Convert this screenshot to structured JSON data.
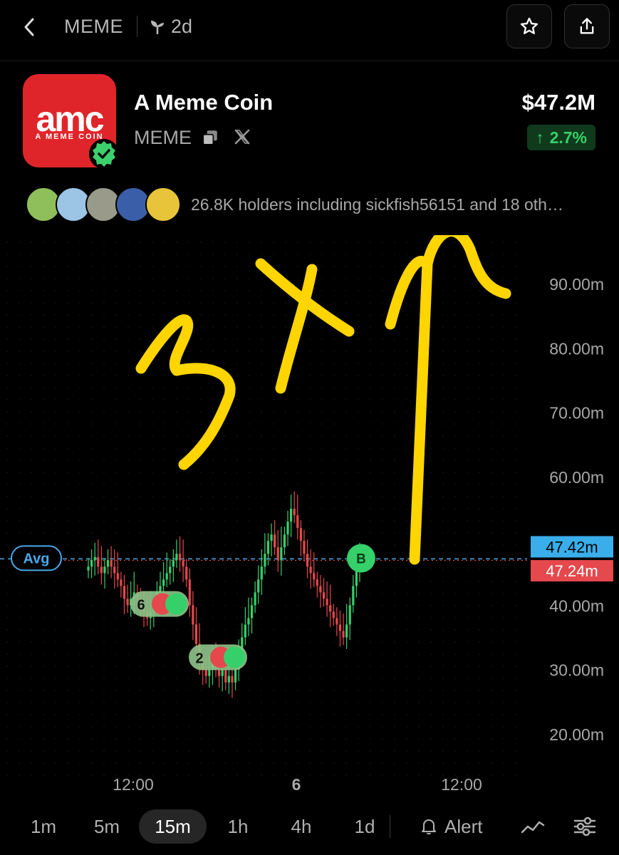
{
  "header": {
    "ticker": "MEME",
    "age": "2d"
  },
  "token": {
    "logo_wordmark": "amc",
    "logo_sub": "A MEME COIN",
    "name": "A Meme Coin",
    "symbol": "MEME",
    "market_cap": "$47.2M",
    "change": "2.7%",
    "change_arrow": "↑"
  },
  "holders": {
    "text": "26.8K holders including sickfish56151 and 18 oth…",
    "avatar_colors": [
      "#8fbf5a",
      "#9cc4e4",
      "#9a9a8a",
      "#3a5fa8",
      "#e8c43a"
    ]
  },
  "colors": {
    "up": "#35d06a",
    "down": "#e5484d",
    "annotation": "#ffd500",
    "avg_line": "#4aa8e8"
  },
  "chart_data": {
    "type": "candlestick",
    "y_unit": "market cap (m)",
    "y_ticks": [
      "90.00m",
      "80.00m",
      "70.00m",
      "60.00m",
      "40.00m",
      "30.00m",
      "20.00m"
    ],
    "y_tick_values": [
      90,
      80,
      70,
      60,
      40,
      30,
      20
    ],
    "ylim": [
      15,
      97
    ],
    "x_ticks": [
      "12:00",
      "6",
      "12:00"
    ],
    "avg_label": "Avg",
    "avg_value": 47.42,
    "current_label": "47.24m",
    "current_value": 47.24,
    "avg_price_label": "47.42m",
    "trade_markers": [
      {
        "label": "6",
        "at_value": 40.2
      },
      {
        "label": "2",
        "at_value": 31.9
      },
      {
        "label": "B",
        "at_value": 47.3
      }
    ],
    "candles_close": [
      46,
      47,
      47.5,
      46,
      45,
      46,
      47,
      46,
      45,
      44,
      43,
      41,
      40,
      41,
      42,
      41,
      40,
      39,
      38,
      39,
      40,
      42,
      43,
      44,
      45,
      46,
      47,
      48,
      47,
      46,
      44,
      40,
      37,
      34,
      31,
      30,
      29,
      30,
      31,
      30,
      29,
      30,
      28,
      29,
      28,
      30,
      33,
      35,
      37,
      38,
      40,
      42,
      44,
      46,
      48,
      50,
      51,
      49,
      47,
      49,
      51,
      53,
      55,
      54,
      52,
      50,
      48,
      46,
      45,
      44,
      43,
      42,
      41,
      40,
      39,
      38,
      37,
      36,
      35,
      37,
      40,
      43,
      46,
      47
    ],
    "annotation": "3X↑"
  },
  "timeframes": [
    "1m",
    "5m",
    "15m",
    "1h",
    "4h",
    "1d"
  ],
  "active_timeframe": "15m",
  "alert_label": "Alert"
}
